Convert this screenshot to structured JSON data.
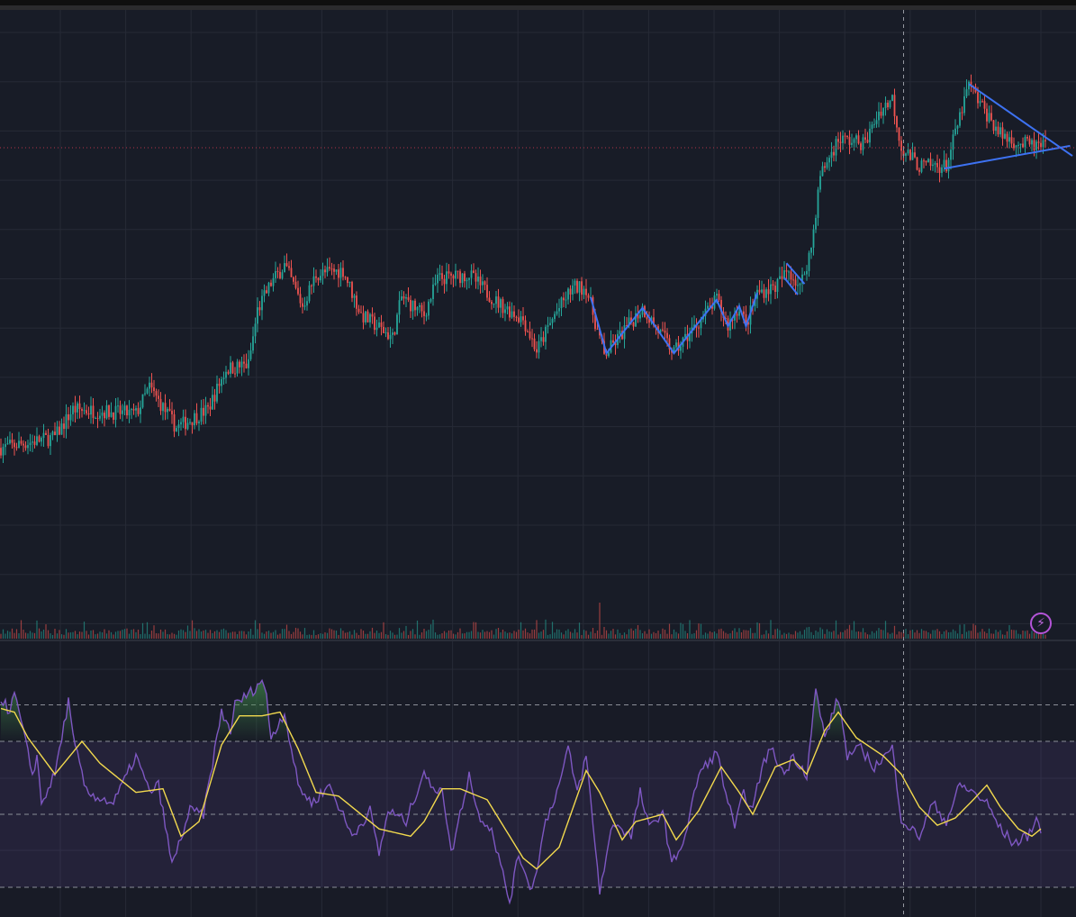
{
  "colors": {
    "background": "#181c27",
    "grid": "#262a36",
    "up": "#26a69a",
    "down": "#ef5350",
    "rsi": "#7e57c2",
    "rsi_signal": "#f2d94e",
    "rsi_band": "#7e57c2",
    "drawing": "#3d72f2",
    "last_price_line": "#b2354a",
    "crosshair": "#9598a1",
    "alert_icon": "#b454d8"
  },
  "toolbar": {
    "alert_icon": "lightning-icon",
    "alert_glyph": "⚡"
  },
  "chart_data": [
    {
      "type": "candlestick",
      "pane": "price",
      "grid": true,
      "x_unit": "bar index",
      "close_path": [
        [
          0,
          30.4
        ],
        [
          24,
          32.1
        ],
        [
          32,
          36.5
        ],
        [
          60,
          35.8
        ],
        [
          66,
          40
        ],
        [
          78,
          33.6
        ],
        [
          92,
          36.5
        ],
        [
          100,
          42.9
        ],
        [
          110,
          43.6
        ],
        [
          114,
          52.2
        ],
        [
          120,
          56.5
        ],
        [
          126,
          59.4
        ],
        [
          134,
          52.9
        ],
        [
          140,
          57.9
        ],
        [
          152,
          58.6
        ],
        [
          160,
          51.5
        ],
        [
          174,
          47.9
        ],
        [
          178,
          54.3
        ],
        [
          188,
          51.5
        ],
        [
          194,
          57.2
        ],
        [
          208,
          57.9
        ],
        [
          220,
          53.6
        ],
        [
          232,
          50.8
        ],
        [
          238,
          45.8
        ],
        [
          246,
          51.5
        ],
        [
          254,
          55.8
        ],
        [
          260,
          55.8
        ],
        [
          268,
          45
        ],
        [
          285,
          52.6
        ],
        [
          299,
          45.5
        ],
        [
          318,
          53.9
        ],
        [
          323,
          49.8
        ],
        [
          328,
          52.9
        ],
        [
          331,
          49.8
        ],
        [
          336,
          55
        ],
        [
          344,
          56
        ],
        [
          350,
          58.6
        ],
        [
          355,
          55.8
        ],
        [
          360,
          62.2
        ],
        [
          364,
          73.6
        ],
        [
          372,
          79.4
        ],
        [
          384,
          78.7
        ],
        [
          390,
          83.7
        ],
        [
          396,
          85.8
        ],
        [
          400,
          78
        ],
        [
          408,
          75.1
        ],
        [
          420,
          75.1
        ],
        [
          430,
          88
        ],
        [
          436,
          84.4
        ],
        [
          444,
          80.1
        ],
        [
          452,
          78.7
        ],
        [
          464,
          78
        ]
      ],
      "last_price": 78,
      "crosshair_bar": 401,
      "volume_spike_bar": 266,
      "drawings": [
        {
          "type": "zigzag",
          "points": [
            [
              262,
              54.3
            ],
            [
              269,
              45.4
            ],
            [
              285,
              52.6
            ],
            [
              299,
              45.4
            ],
            [
              318,
              53.9
            ],
            [
              323,
              49.7
            ],
            [
              328,
              52.9
            ],
            [
              331,
              49.7
            ],
            [
              336,
              55
            ]
          ]
        },
        {
          "type": "trendline",
          "points": [
            [
              349,
              59.7
            ],
            [
              357,
              56.4
            ]
          ]
        },
        {
          "type": "trendline",
          "points": [
            [
              348,
              57.4
            ],
            [
              354,
              54.7
            ]
          ]
        },
        {
          "type": "trendline",
          "points": [
            [
              430,
              88.1
            ],
            [
              476,
              76.7
            ]
          ]
        },
        {
          "type": "trendline",
          "points": [
            [
              419,
              74.7
            ],
            [
              475,
              78.3
            ]
          ]
        }
      ]
    },
    {
      "type": "line",
      "pane": "rsi",
      "levels": [
        80,
        70,
        50,
        30
      ],
      "band": [
        30,
        70
      ],
      "series": [
        {
          "key": "rsi",
          "values": [
            [
              0,
              82
            ],
            [
              4,
              78
            ],
            [
              6,
              83
            ],
            [
              8,
              78
            ],
            [
              14,
              61
            ],
            [
              16,
              66
            ],
            [
              18,
              53
            ],
            [
              24,
              61
            ],
            [
              30,
              81
            ],
            [
              32,
              71
            ],
            [
              38,
              56
            ],
            [
              50,
              53
            ],
            [
              60,
              66
            ],
            [
              66,
              56
            ],
            [
              70,
              58
            ],
            [
              76,
              36
            ],
            [
              84,
              51
            ],
            [
              90,
              50
            ],
            [
              98,
              78
            ],
            [
              102,
              73
            ],
            [
              104,
              80
            ],
            [
              112,
              84
            ],
            [
              116,
              87
            ],
            [
              118,
              82
            ],
            [
              120,
              71
            ],
            [
              126,
              78
            ],
            [
              132,
              58
            ],
            [
              138,
              53
            ],
            [
              146,
              58
            ],
            [
              156,
              44
            ],
            [
              164,
              51
            ],
            [
              168,
              39
            ],
            [
              172,
              51
            ],
            [
              180,
              48
            ],
            [
              188,
              62
            ],
            [
              192,
              56
            ],
            [
              196,
              58
            ],
            [
              200,
              39
            ],
            [
              208,
              61
            ],
            [
              212,
              50
            ],
            [
              218,
              46
            ],
            [
              226,
              26
            ],
            [
              230,
              39
            ],
            [
              236,
              29
            ],
            [
              242,
              48
            ],
            [
              248,
              58
            ],
            [
              252,
              68
            ],
            [
              256,
              56
            ],
            [
              260,
              66
            ],
            [
              266,
              29
            ],
            [
              272,
              48
            ],
            [
              280,
              44
            ],
            [
              284,
              56
            ],
            [
              288,
              46
            ],
            [
              294,
              51
            ],
            [
              298,
              36
            ],
            [
              304,
              44
            ],
            [
              310,
              61
            ],
            [
              318,
              67
            ],
            [
              322,
              56
            ],
            [
              326,
              46
            ],
            [
              330,
              56
            ],
            [
              334,
              51
            ],
            [
              338,
              63
            ],
            [
              342,
              68
            ],
            [
              348,
              61
            ],
            [
              352,
              66
            ],
            [
              358,
              61
            ],
            [
              362,
              84
            ],
            [
              366,
              71
            ],
            [
              372,
              82
            ],
            [
              376,
              66
            ],
            [
              382,
              68
            ],
            [
              388,
              63
            ],
            [
              396,
              68
            ],
            [
              400,
              49
            ],
            [
              404,
              46
            ],
            [
              408,
              44
            ],
            [
              414,
              53
            ],
            [
              420,
              48
            ],
            [
              426,
              58
            ],
            [
              432,
              56
            ],
            [
              438,
              53
            ],
            [
              444,
              46
            ],
            [
              450,
              42
            ],
            [
              456,
              44
            ],
            [
              460,
              49
            ],
            [
              462,
              45
            ]
          ]
        },
        {
          "key": "signal",
          "values": [
            [
              0,
              79
            ],
            [
              6,
              78
            ],
            [
              12,
              71
            ],
            [
              24,
              61
            ],
            [
              36,
              70
            ],
            [
              44,
              64
            ],
            [
              60,
              56
            ],
            [
              72,
              57
            ],
            [
              80,
              44
            ],
            [
              88,
              48
            ],
            [
              98,
              69
            ],
            [
              106,
              77
            ],
            [
              116,
              77
            ],
            [
              124,
              78
            ],
            [
              132,
              68
            ],
            [
              140,
              56
            ],
            [
              150,
              55
            ],
            [
              160,
              50
            ],
            [
              168,
              46
            ],
            [
              182,
              44
            ],
            [
              188,
              48
            ],
            [
              196,
              57
            ],
            [
              204,
              57
            ],
            [
              216,
              54
            ],
            [
              224,
              46
            ],
            [
              232,
              38
            ],
            [
              238,
              35
            ],
            [
              248,
              41
            ],
            [
              260,
              62
            ],
            [
              266,
              56
            ],
            [
              276,
              43
            ],
            [
              282,
              48
            ],
            [
              294,
              50
            ],
            [
              300,
              43
            ],
            [
              310,
              51
            ],
            [
              320,
              63
            ],
            [
              328,
              56
            ],
            [
              334,
              50
            ],
            [
              344,
              63
            ],
            [
              352,
              65
            ],
            [
              358,
              61
            ],
            [
              366,
              73
            ],
            [
              372,
              78
            ],
            [
              380,
              71
            ],
            [
              392,
              66
            ],
            [
              400,
              61
            ],
            [
              408,
              52
            ],
            [
              416,
              47
            ],
            [
              424,
              49
            ],
            [
              432,
              54
            ],
            [
              438,
              58
            ],
            [
              444,
              52
            ],
            [
              452,
              46
            ],
            [
              458,
              44
            ],
            [
              462,
              46
            ]
          ]
        }
      ]
    }
  ]
}
